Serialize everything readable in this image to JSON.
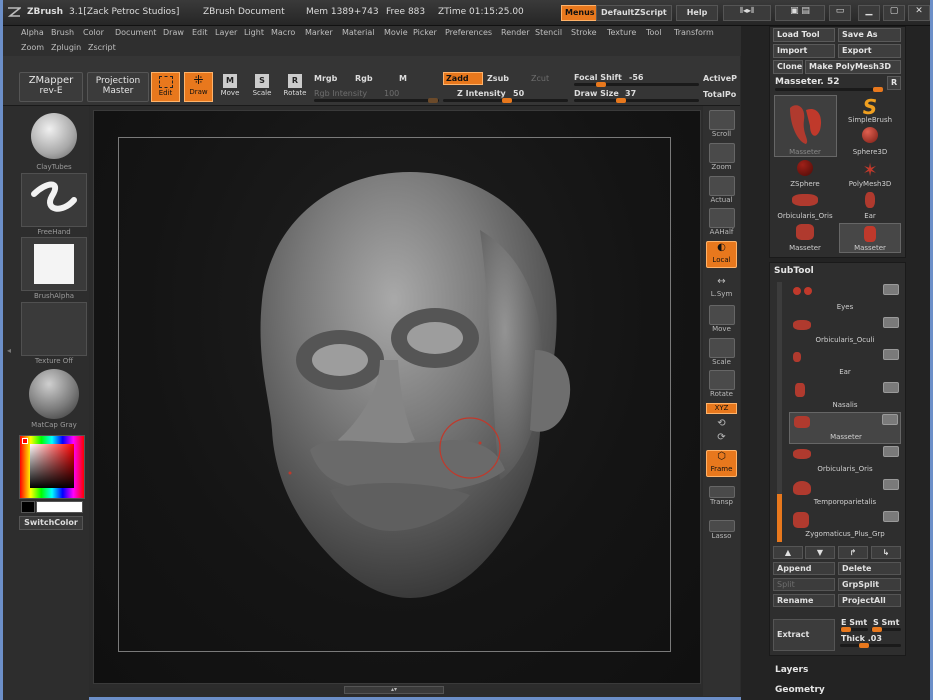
{
  "titlebar": {
    "app": "ZBrush",
    "version": "3.1[Zack Petroc Studios]",
    "document": "ZBrush Document",
    "mem": "Mem 1389+743",
    "free": "Free 883",
    "ztime": "ZTime 01:15:25.00",
    "menus_btn": "Menus",
    "script_btn": "DefaultZScript",
    "help_btn": "Help"
  },
  "menus": {
    "row1": [
      "Alpha",
      "Brush",
      "Color",
      "Document",
      "Draw",
      "Edit",
      "Layer",
      "Light",
      "Macro",
      "Marker",
      "Material",
      "Movie",
      "Picker",
      "Preferences",
      "Render",
      "Stencil",
      "Stroke",
      "Texture",
      "Tool",
      "Transform"
    ],
    "row2": [
      "Zoom",
      "Zplugin",
      "Zscript"
    ]
  },
  "toolbar": {
    "zmapper": "ZMapper",
    "zmapper_sub": "rev-E",
    "projection": "Projection",
    "projection_sub": "Master",
    "edit": "Edit",
    "draw": "Draw",
    "move": "Move",
    "scale": "Scale",
    "rotate": "Rotate",
    "mrgb": "Mrgb",
    "rgb": "Rgb",
    "m": "M",
    "rgb_intensity_label": "Rgb Intensity",
    "rgb_intensity": "100",
    "zadd": "Zadd",
    "zsub": "Zsub",
    "zcut": "Zcut",
    "z_intensity_label": "Z Intensity",
    "z_intensity": "50",
    "focal_shift_label": "Focal Shift",
    "focal_shift": "-56",
    "draw_size_label": "Draw Size",
    "draw_size": "37",
    "active_points": "ActiveP",
    "total_points": "TotalPo"
  },
  "leftpanel": {
    "brush": "ClayTubes",
    "stroke": "FreeHand",
    "alpha": "BrushAlpha",
    "texture": "Texture Off",
    "material": "MatCap Gray",
    "switch_color": "SwitchColor"
  },
  "rightshelf": [
    "Scroll",
    "Zoom",
    "Actual",
    "AAHalf",
    "Local",
    "L.Sym",
    "Move",
    "Scale",
    "Rotate",
    "XYZ",
    "Frame",
    "Transp",
    "Lasso"
  ],
  "tool": {
    "load": "Load Tool",
    "save": "Save As",
    "import": "Import",
    "export": "Export",
    "clone": "Clone",
    "make": "Make PolyMesh3D",
    "current": "Masseter. 52",
    "r": "R",
    "items": [
      "Masseter",
      "SimpleBrush",
      "Sphere3D",
      "ZSphere",
      "PolyMesh3D",
      "Orbicularis_Oris",
      "Ear",
      "Masseter",
      "Masseter"
    ]
  },
  "subtool": {
    "title": "SubTool",
    "items": [
      "Eyes",
      "Orbicularis_Oculi",
      "Ear",
      "Nasalis",
      "Masseter",
      "Orbicularis_Oris",
      "Temporoparietalis",
      "Zygomaticus_Plus_Grp"
    ],
    "append": "Append",
    "delete": "Delete",
    "split": "Split",
    "grpsplit": "GrpSplit",
    "rename": "Rename",
    "projectall": "ProjectAll",
    "extract": "Extract",
    "e_smt": "E Smt",
    "s_smt": "S Smt",
    "thick": "Thick .03"
  },
  "tray_bottom": {
    "layers": "Layers",
    "geometry": "Geometry"
  },
  "colors": {
    "accent": "#e8781d",
    "subtool_red": "#c0392b"
  }
}
